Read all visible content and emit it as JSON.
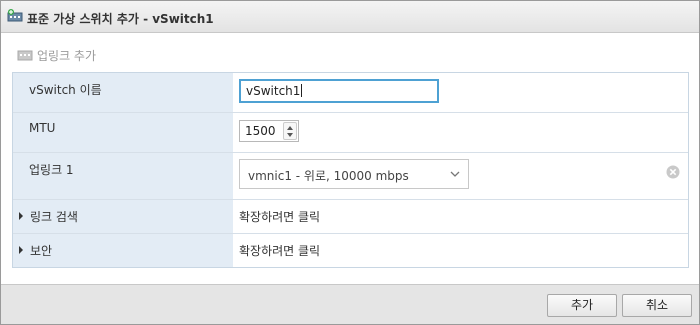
{
  "dialog": {
    "title": "표준 가상 스위치 추가 - vSwitch1",
    "toolbar": {
      "add_uplink_label": "업링크 추가"
    },
    "fields": {
      "name": {
        "label": "vSwitch 이름",
        "value": "vSwitch1"
      },
      "mtu": {
        "label": "MTU",
        "value": "1500"
      },
      "uplink1": {
        "label": "업링크 1",
        "selected": "vmnic1 - 위로, 10000 mbps"
      },
      "link_discovery": {
        "label": "링크 검색",
        "value": "확장하려면 클릭"
      },
      "security": {
        "label": "보안",
        "value": "확장하려면 클릭"
      }
    },
    "buttons": {
      "ok_label": "추가",
      "cancel_label": "취소"
    }
  },
  "colors": {
    "label_bg": "#e3ecf5",
    "focus_border": "#4ea1d3",
    "footer_bg": "#e5e5e5"
  }
}
